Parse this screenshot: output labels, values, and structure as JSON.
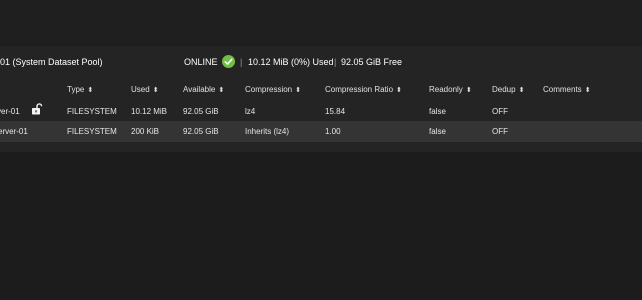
{
  "pool": {
    "name": "01   (System Dataset Pool)",
    "status": "ONLINE",
    "separator": "|",
    "used": "10.12 MiB (0%) Used",
    "free": "92.05 GiB Free"
  },
  "table": {
    "sort_glyph": "⬍",
    "columns": [
      {
        "label": "Type"
      },
      {
        "label": "Used"
      },
      {
        "label": "Available"
      },
      {
        "label": "Compression"
      },
      {
        "label": "Compression Ratio"
      },
      {
        "label": "Readonly"
      },
      {
        "label": "Dedup"
      },
      {
        "label": "Comments"
      }
    ],
    "rows": [
      {
        "name": "ver-01",
        "type": "FILESYSTEM",
        "used": "10.12 MiB",
        "available": "92.05 GiB",
        "compression": "lz4",
        "ratio": "15.84",
        "readonly": "false",
        "dedup": "OFF",
        "comments": ""
      },
      {
        "name": "erver-01",
        "type": "FILESYSTEM",
        "used": "200 KiB",
        "available": "92.05 GiB",
        "compression": "Inherits (lz4)",
        "ratio": "1.00",
        "readonly": "false",
        "dedup": "OFF",
        "comments": ""
      }
    ]
  },
  "icons": {
    "status_check": "check-circle-icon",
    "lock": "lock-open-icon"
  },
  "colors": {
    "status_ok": "#71bf44",
    "background": "#1c1c1c",
    "row_highlight": "#343434"
  }
}
